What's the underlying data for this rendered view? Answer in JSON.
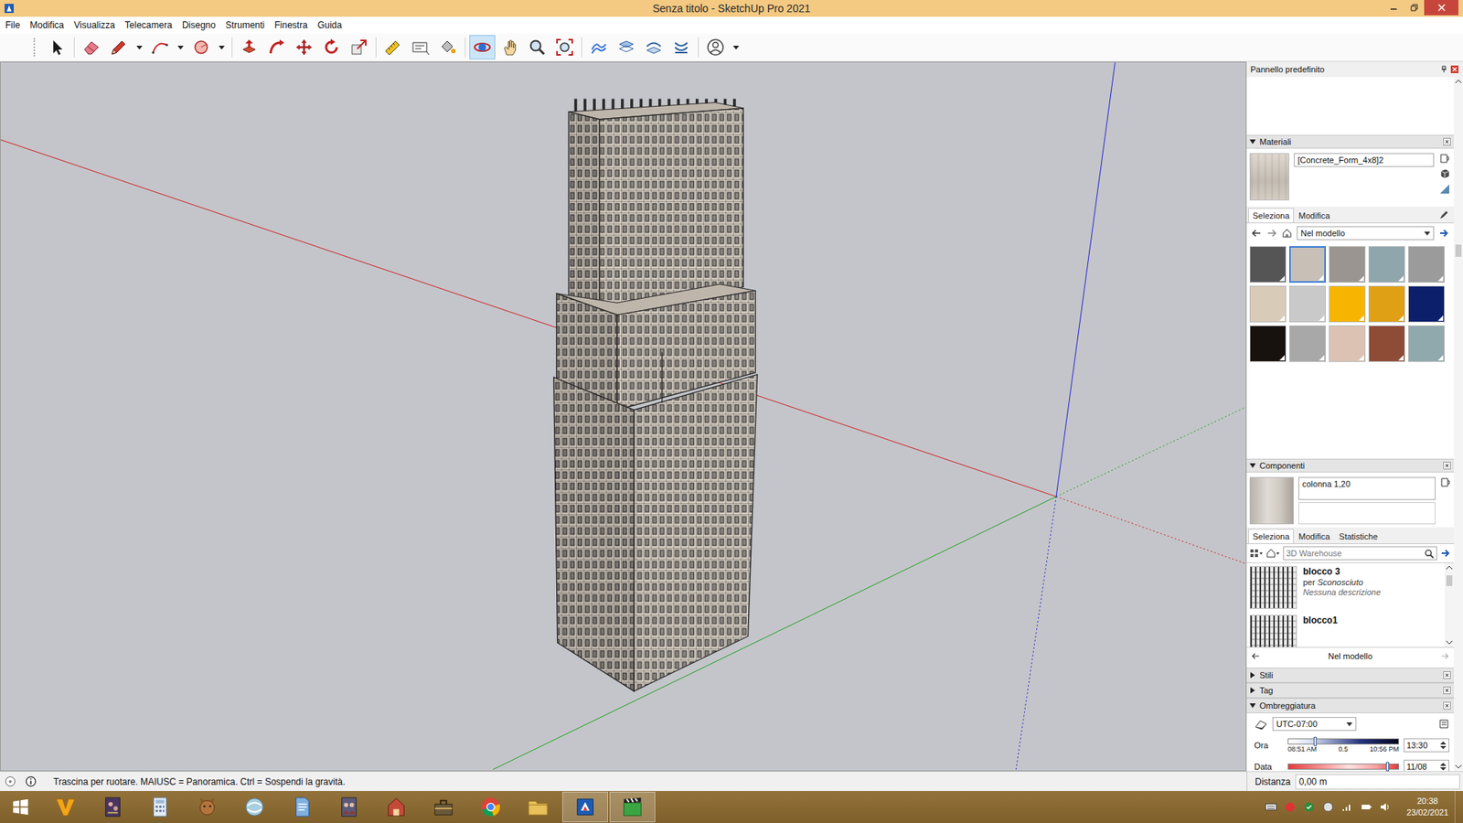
{
  "window": {
    "title": "Senza titolo - SketchUp Pro 2021"
  },
  "menu": [
    {
      "label": "File"
    },
    {
      "label": "Modifica"
    },
    {
      "label": "Visualizza"
    },
    {
      "label": "Telecamera"
    },
    {
      "label": "Disegno"
    },
    {
      "label": "Strumenti"
    },
    {
      "label": "Finestra"
    },
    {
      "label": "Guida"
    }
  ],
  "toolbar": {
    "tools": [
      {
        "selected": false,
        "dropdown": false
      },
      {
        "selected": false,
        "dropdown": false
      },
      {
        "selected": false,
        "dropdown": true
      },
      {
        "selected": false,
        "dropdown": true
      },
      {
        "selected": false,
        "dropdown": true
      },
      {
        "selected": false,
        "dropdown": false
      },
      {
        "selected": false,
        "dropdown": false
      },
      {
        "selected": false,
        "dropdown": false
      },
      {
        "selected": false,
        "dropdown": false
      },
      {
        "selected": false,
        "dropdown": false
      },
      {
        "selected": false,
        "dropdown": false
      },
      {
        "selected": false,
        "dropdown": false
      },
      {
        "selected": false,
        "dropdown": false
      },
      {
        "selected": true,
        "dropdown": false
      },
      {
        "selected": false,
        "dropdown": false
      },
      {
        "selected": false,
        "dropdown": false
      },
      {
        "selected": false,
        "dropdown": false
      },
      {
        "selected": false,
        "dropdown": false
      },
      {
        "selected": false,
        "dropdown": false
      },
      {
        "selected": false,
        "dropdown": false
      },
      {
        "selected": false,
        "dropdown": false
      },
      {
        "selected": false,
        "dropdown": true
      }
    ]
  },
  "panel": {
    "title": "Pannello predefinito",
    "materials": {
      "header": "Materiali",
      "expanded": true,
      "name": "[Concrete_Form_4x8]2",
      "tabs": [
        {
          "label": "Seleziona",
          "selected": true
        },
        {
          "label": "Modifica",
          "selected": false
        }
      ],
      "library": "Nel modello",
      "swatches": [
        {
          "color": "#555555",
          "selected": false
        },
        {
          "color": "#c8c0b6",
          "selected": true
        },
        {
          "color": "#9a9590",
          "selected": false
        },
        {
          "color": "#8ea6ac",
          "selected": false
        },
        {
          "color": "#9b9b9b",
          "selected": false
        },
        {
          "color": "#d8cbb8",
          "selected": false
        },
        {
          "color": "#c9c9c9",
          "selected": false
        },
        {
          "color": "#f7b400",
          "selected": false
        },
        {
          "color": "#e0a015",
          "selected": false
        },
        {
          "color": "#0b1f6b",
          "selected": false
        },
        {
          "color": "#17120d",
          "selected": false
        },
        {
          "color": "#a8a8a8",
          "selected": false
        },
        {
          "color": "#dcc2b3",
          "selected": false
        },
        {
          "color": "#8e4b36",
          "selected": false
        },
        {
          "color": "#8fa9ad",
          "selected": false
        }
      ]
    },
    "components": {
      "header": "Componenti",
      "expanded": true,
      "name": "colonna 1,20",
      "tabs": [
        {
          "label": "Seleziona",
          "selected": true
        },
        {
          "label": "Modifica",
          "selected": false
        },
        {
          "label": "Statistiche",
          "selected": false
        }
      ],
      "search_placeholder": "3D Warehouse",
      "items": [
        {
          "name": "blocco 3",
          "by": "per",
          "author": "Sconosciuto",
          "description": "Nessuna descrizione"
        },
        {
          "name": "blocco1"
        }
      ],
      "footer": "Nel modello"
    },
    "sections": [
      {
        "label": "Stili",
        "expanded": false
      },
      {
        "label": "Tag",
        "expanded": false
      },
      {
        "label": "Ombreggiatura",
        "expanded": true
      }
    ],
    "shadows": {
      "timezone": "UTC-07:00",
      "time_label": "Ora",
      "time_start": "08:51 AM",
      "time_mid": "0.5",
      "time_end": "10:56 PM",
      "time_value": "13:30",
      "time_level": 0.24,
      "date_label": "Data",
      "date_value": "11/08",
      "date_level": 0.9
    }
  },
  "status_bar": {
    "hint": "Trascina per ruotare. MAIUSC = Panoramica. Ctrl = Sospendi la gravità.",
    "distance_label": "Distanza",
    "distance_value": "0,00 m"
  },
  "taskbar": {
    "apps": [
      {
        "active": false
      },
      {
        "active": false
      },
      {
        "active": false
      },
      {
        "active": false
      },
      {
        "active": false
      },
      {
        "active": false
      },
      {
        "active": false
      },
      {
        "active": false
      },
      {
        "active": false
      },
      {
        "active": false
      },
      {
        "active": false
      },
      {
        "active": true
      },
      {
        "active": true
      }
    ],
    "time": "20:38",
    "date": "23/02/2021"
  }
}
